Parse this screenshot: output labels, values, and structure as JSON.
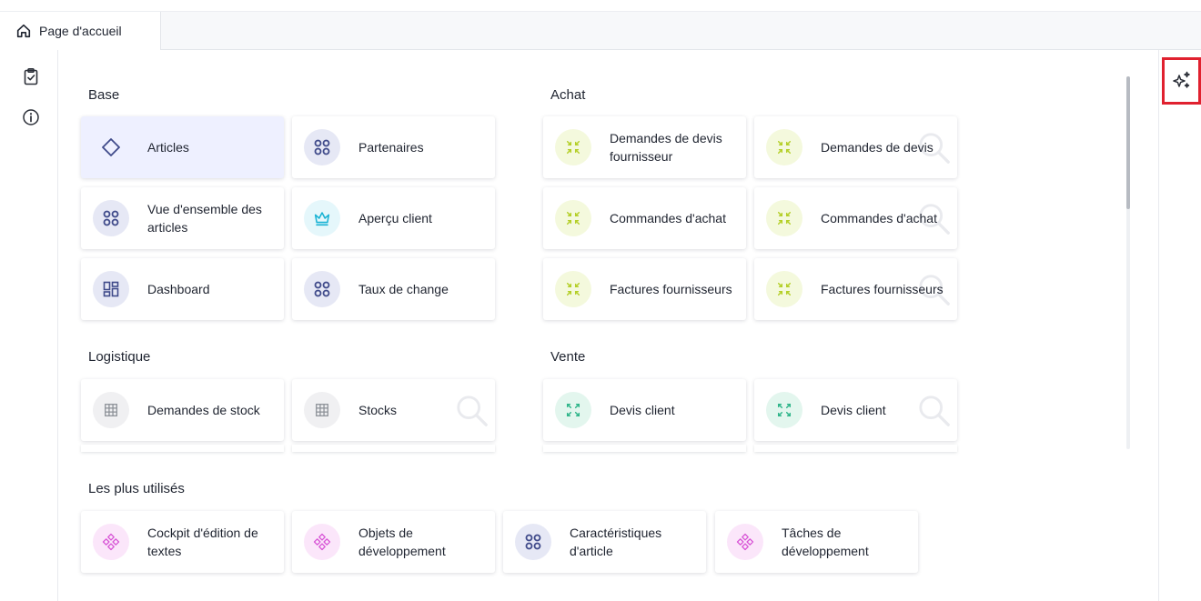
{
  "tabbar": {
    "home_tab": "Page d'accueil"
  },
  "sections": {
    "base": {
      "title": "Base",
      "items": [
        "Articles",
        "Partenaires",
        "Vue d'ensemble des articles",
        "Aperçu client",
        "Dashboard",
        "Taux de change"
      ]
    },
    "achat": {
      "title": "Achat",
      "items": [
        "Demandes de devis fournisseur",
        "Demandes de devis",
        "Commandes d'achat",
        "Commandes d'achat",
        "Factures fournisseurs",
        "Factures fournisseurs"
      ]
    },
    "logistique": {
      "title": "Logistique",
      "items": [
        "Demandes de stock",
        "Stocks"
      ]
    },
    "vente": {
      "title": "Vente",
      "items": [
        "Devis client",
        "Devis client"
      ]
    },
    "most_used": {
      "title": "Les plus utilisés",
      "items": [
        "Cockpit d'édition de textes",
        "Objets de développement",
        "Caractéristiques d'article",
        "Tâches de développement"
      ]
    }
  },
  "icons": {
    "home": "home-icon",
    "clipboard": "clipboard-check-icon",
    "info": "info-icon",
    "ai": "sparkle-icon",
    "diamond": "diamond-icon",
    "grid": "four-circles-icon",
    "crown": "crown-icon",
    "dashboard": "dashboard-icon",
    "compress": "compress-arrows-icon",
    "expand": "expand-arrows-icon",
    "table": "table-grid-icon",
    "diamonds": "four-diamonds-icon",
    "search_watermark": "search-icon"
  },
  "colors": {
    "indigo": "#3f4a8a",
    "cyan": "#19b3d4",
    "lime": "#b4cf27",
    "mint": "#2fb58a",
    "pink": "#d855d6",
    "grey": "#8b8f96",
    "highlight": "#e0212f"
  }
}
